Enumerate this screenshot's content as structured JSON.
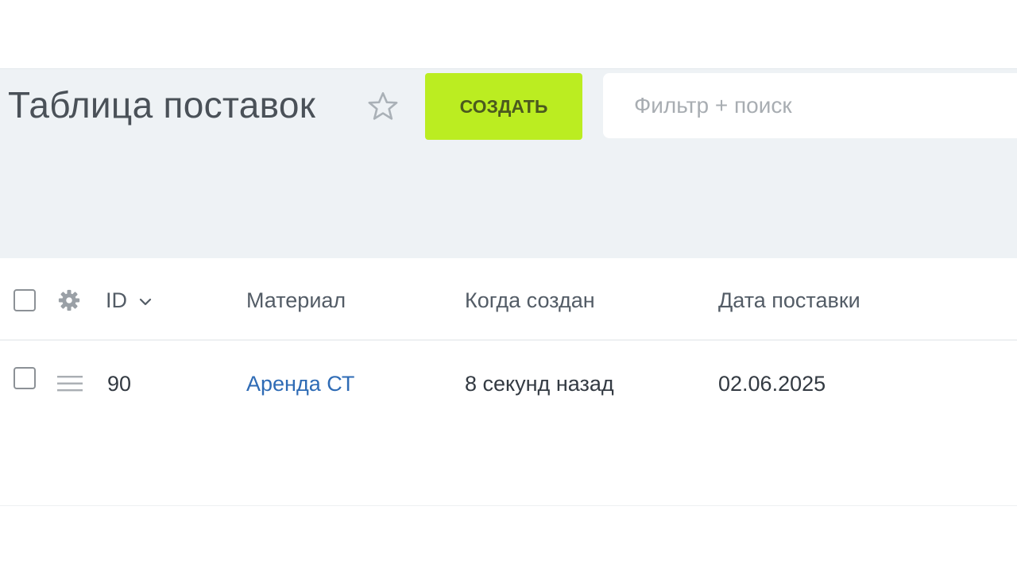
{
  "header": {
    "title": "Таблица поставок",
    "create_label": "СОЗДАТЬ",
    "search_placeholder": "Фильтр + поиск"
  },
  "table": {
    "columns": [
      "ID",
      "Материал",
      "Когда создан",
      "Дата поставки"
    ],
    "sort_column": "ID",
    "rows": [
      {
        "id": "90",
        "material": "Аренда СТ",
        "created": "8 секунд назад",
        "delivery_date": "02.06.2025"
      }
    ]
  },
  "colors": {
    "accent_button": "#bbed21",
    "link": "#2e6bb5",
    "header_background": "#eef2f5"
  },
  "icons": [
    "star-icon",
    "gear-icon",
    "chevron-down-icon",
    "menu-icon"
  ]
}
